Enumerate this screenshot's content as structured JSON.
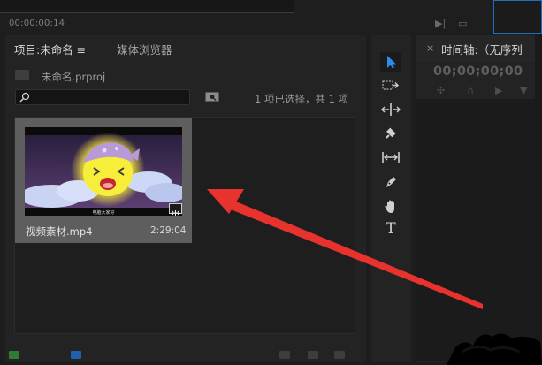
{
  "top": {
    "timecode": "00:00:00:14"
  },
  "project_panel": {
    "tab_project": "项目:未命名 ≡",
    "tab_media_browser": "媒体浏览器",
    "project_file": "未命名.prproj",
    "search": {
      "value": "",
      "placeholder": ""
    },
    "selection_info": "1 项已选择，共 1 项",
    "clip": {
      "name": "视频素材.mp4",
      "duration": "2:29:04",
      "thumb_caption": "电脑大家好"
    }
  },
  "tools": [
    {
      "name": "selection-tool",
      "icon": "selection-arrow-icon",
      "selected": true
    },
    {
      "name": "track-select-tool",
      "icon": "track-select-icon"
    },
    {
      "name": "ripple-edit-tool",
      "icon": "ripple-edit-icon"
    },
    {
      "name": "razor-tool",
      "icon": "razor-icon"
    },
    {
      "name": "slip-tool",
      "icon": "slip-icon"
    },
    {
      "name": "pen-tool",
      "icon": "pen-icon"
    },
    {
      "name": "hand-tool",
      "icon": "hand-icon"
    },
    {
      "name": "type-tool",
      "icon": "type-icon",
      "glyph": "T"
    }
  ],
  "timeline": {
    "close": "×",
    "title": "时间轴:（无序列",
    "timecode": "00;00;00;00"
  },
  "colors": {
    "accent_blue": "#2d8ceb",
    "annotation_red": "#e8322e"
  }
}
